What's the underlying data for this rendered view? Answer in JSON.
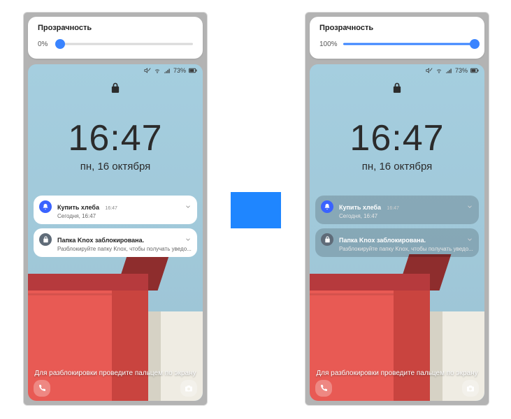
{
  "transparency": {
    "label": "Прозрачность",
    "left_value": "0%",
    "right_value": "100%"
  },
  "status": {
    "battery_pct": "73%"
  },
  "clock": {
    "time": "16:47",
    "date": "пн, 16 октября"
  },
  "notifications": [
    {
      "icon": "bell",
      "icon_bg": "#3a63ff",
      "title": "Купить хлеба",
      "time_inline": "16:47",
      "text": "Сегодня, 16:47"
    },
    {
      "icon": "lock",
      "icon_bg": "#5f6b78",
      "title": "Папка Knox заблокирована.",
      "time_inline": "",
      "text": "Разблокируйте папку Knox, чтобы получать уведо..."
    }
  ],
  "hint": "Для разблокировки проведите пальцем по экрану"
}
